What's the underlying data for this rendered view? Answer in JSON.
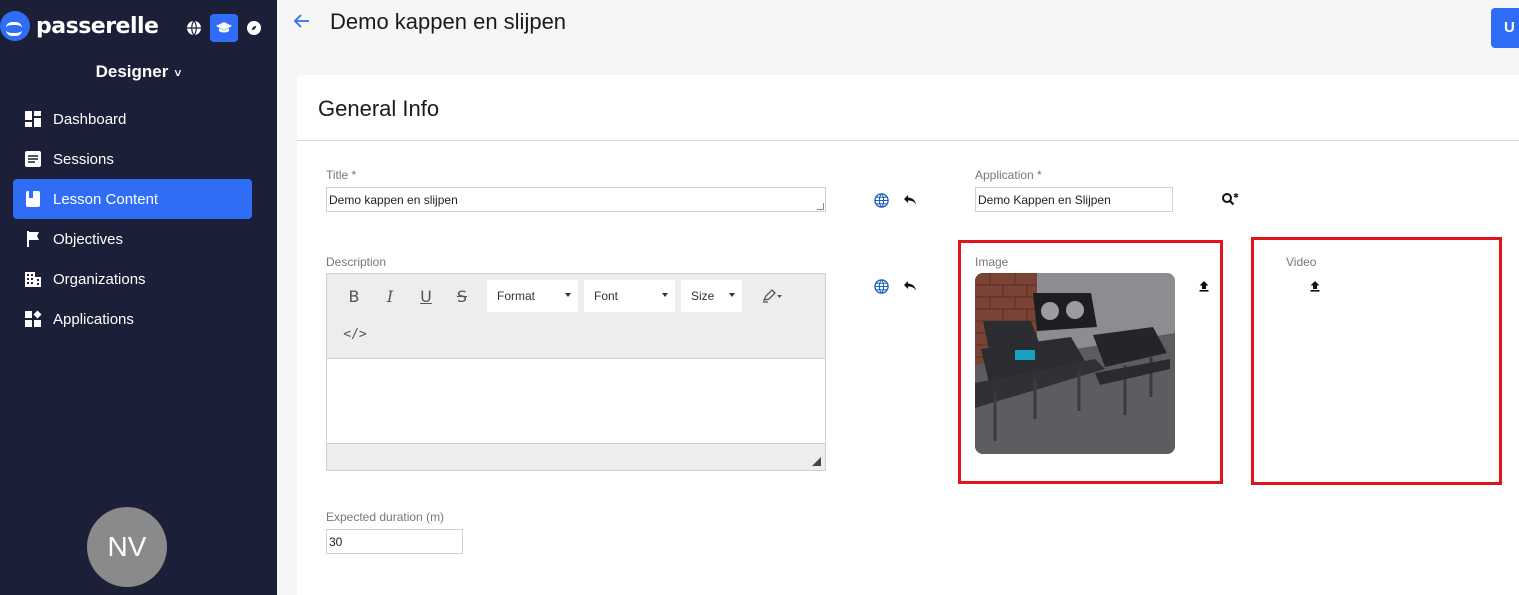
{
  "sidebar": {
    "brand": "passerelle",
    "role": "Designer",
    "nav": [
      {
        "label": "Dashboard",
        "icon": "dashboard-icon"
      },
      {
        "label": "Sessions",
        "icon": "sessions-icon"
      },
      {
        "label": "Lesson Content",
        "icon": "book-icon"
      },
      {
        "label": "Objectives",
        "icon": "flag-icon"
      },
      {
        "label": "Organizations",
        "icon": "building-icon"
      },
      {
        "label": "Applications",
        "icon": "apps-icon"
      }
    ],
    "active_index": 2,
    "avatar_initials": "NV"
  },
  "header": {
    "title": "Demo kappen en slijpen",
    "primary_button": "U"
  },
  "card": {
    "title": "General Info",
    "title_field": {
      "label": "Title *",
      "value": "Demo kappen en slijpen"
    },
    "application_field": {
      "label": "Application *",
      "value": "Demo Kappen en Slijpen"
    },
    "description": {
      "label": "Description"
    },
    "toolbar": {
      "bold": "B",
      "italic": "I",
      "underline": "U",
      "strike": "S",
      "format": "Format",
      "font": "Font",
      "size": "Size",
      "code": "</>"
    },
    "image": {
      "label": "Image"
    },
    "video": {
      "label": "Video"
    },
    "duration": {
      "label": "Expected duration (m)",
      "value": "30"
    }
  },
  "colors": {
    "sidebar_bg": "#1b1f37",
    "accent": "#2f6df6",
    "highlight": "#e0141c"
  }
}
